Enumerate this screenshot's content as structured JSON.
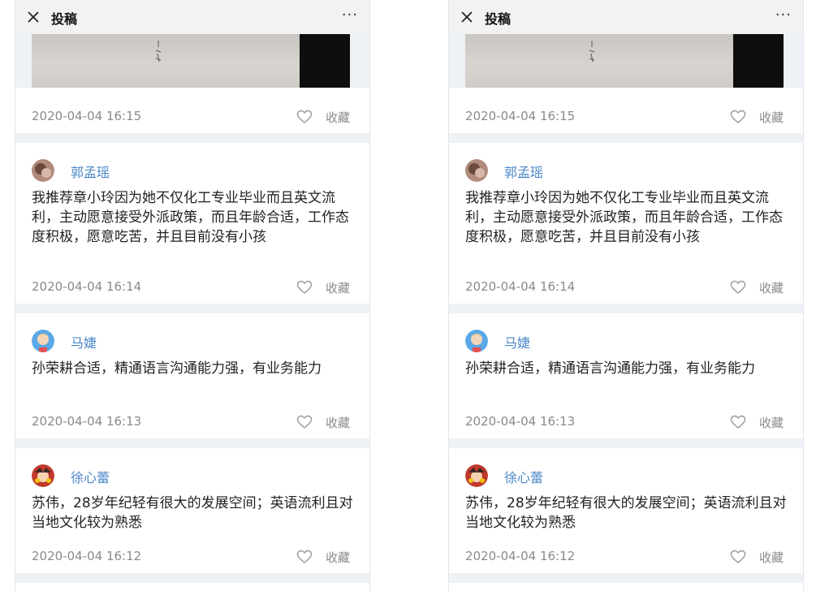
{
  "screens": [
    {
      "topbar": {
        "title": "投稿",
        "more": "···"
      },
      "posts": [
        {
          "time": "2020-04-04 16:15",
          "fav_label": "收藏"
        },
        {
          "author": "郭孟瑶",
          "text": "我推荐章小玲因为她不仅化工专业毕业而且英文流利，主动愿意接受外派政策，而且年龄合适，工作态度积极，愿意吃苦，并且目前没有小孩",
          "time": "2020-04-04 16:14",
          "fav_label": "收藏"
        },
        {
          "author": "马婕",
          "text": "孙荣耕合适，精通语言沟通能力强，有业务能力",
          "time": "2020-04-04 16:13",
          "fav_label": "收藏"
        },
        {
          "author": "徐心蕾",
          "text": "苏伟，28岁年纪轻有很大的发展空间；英语流利且对当地文化较为熟悉",
          "time": "2020-04-04 16:12",
          "fav_label": "收藏"
        }
      ]
    },
    {
      "topbar": {
        "title": "投稿",
        "more": "···"
      },
      "posts": [
        {
          "time": "2020-04-04 16:15",
          "fav_label": "收藏"
        },
        {
          "author": "郭孟瑶",
          "text": "我推荐章小玲因为她不仅化工专业毕业而且英文流利，主动愿意接受外派政策，而且年龄合适，工作态度积极，愿意吃苦，并且目前没有小孩",
          "time": "2020-04-04 16:14",
          "fav_label": "收藏"
        },
        {
          "author": "马婕",
          "text": "孙荣耕合适，精通语言沟通能力强，有业务能力",
          "time": "2020-04-04 16:13",
          "fav_label": "收藏"
        },
        {
          "author": "徐心蕾",
          "text": "苏伟，28岁年纪轻有很大的发展空间；英语流利且对当地文化较为熟悉",
          "time": "2020-04-04 16:12",
          "fav_label": "收藏"
        }
      ]
    }
  ],
  "icons": {
    "close": "close-icon",
    "more": "more-icon",
    "favorite": "heart-icon"
  },
  "colors": {
    "author_name": "#4a86c8",
    "meta_text": "#8a8a8a",
    "feed_background": "#eef1f5"
  }
}
